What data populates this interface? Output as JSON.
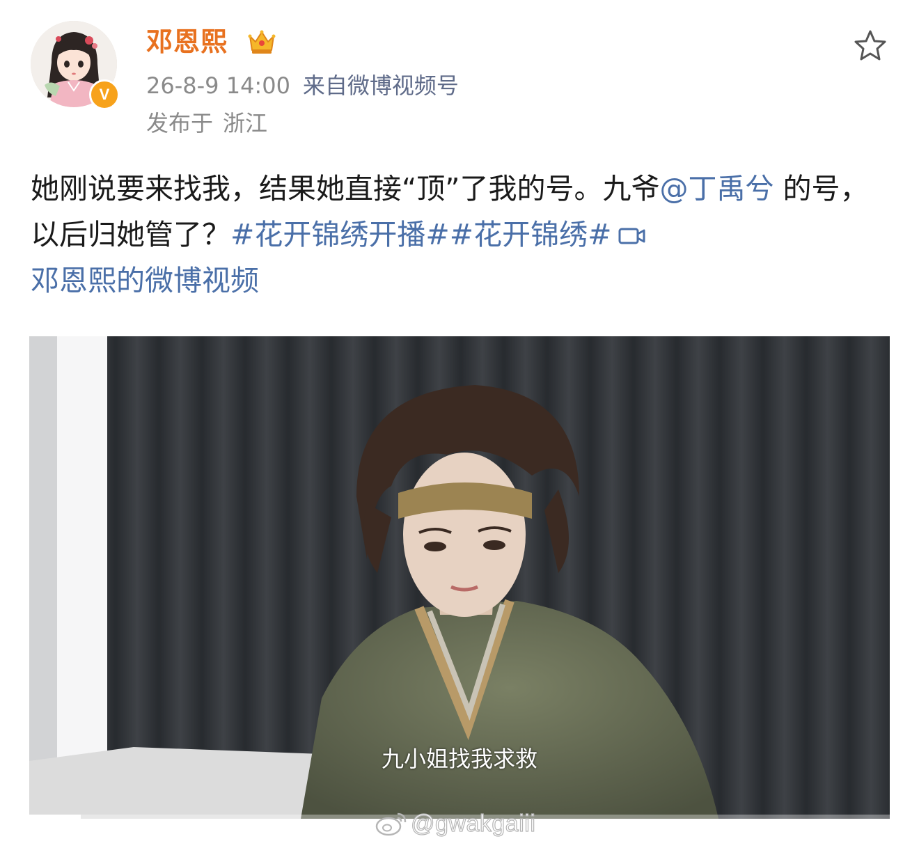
{
  "post": {
    "username": "邓恩熙",
    "timestamp": "26-8-9 14:00",
    "source": "来自微博视频号",
    "location_prefix": "发布于",
    "location": "浙江",
    "text_1": "她刚说要来找我，结果她直接“顶”了我的号。九爷",
    "mention": "@丁禹兮",
    "text_2": " 的号，以后归她管了？",
    "hashtag_1": "#花开锦绣开播#",
    "hashtag_2": "#花开锦绣#",
    "video_link": "邓恩熙的微博视频"
  },
  "video": {
    "subtitle": "九小姐找我求救",
    "progress": 0.06
  },
  "watermark": {
    "handle": "@gwakgaiii"
  },
  "colors": {
    "username": "#e8711f",
    "link": "#4a6fa8",
    "meta": "#8a8a8a",
    "verify_badge": "#f7a21b"
  },
  "icons": {
    "verify": "verified-v-icon",
    "crown": "crown-icon",
    "favorite": "star-outline-icon",
    "video": "video-camera-icon",
    "watermark": "weibo-logo-icon"
  }
}
